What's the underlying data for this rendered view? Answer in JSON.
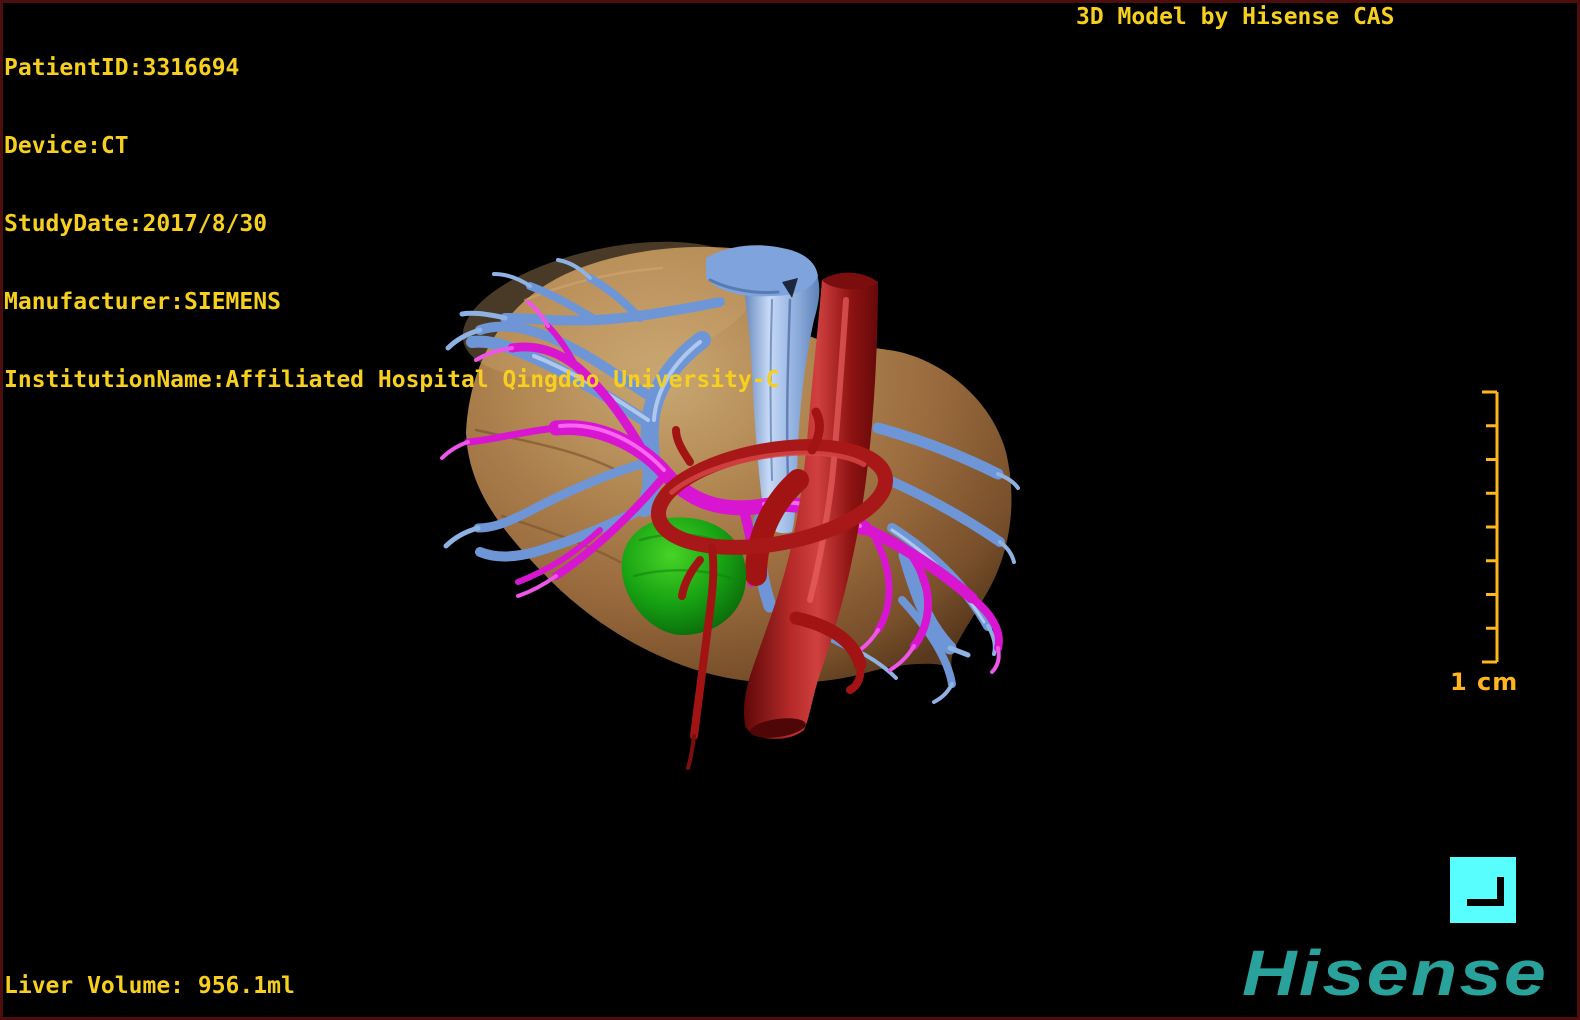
{
  "header": {
    "patient_lines": [
      "PatientID:3316694",
      "Device:CT",
      "StudyDate:2017/8/30",
      "Manufacturer:SIEMENS",
      "InstitutionName:Affiliated Hospital Qingdao University-C"
    ],
    "title": "3D Model by Hisense CAS"
  },
  "footer": {
    "liver_volume": "Liver Volume: 956.1ml",
    "brand": "Hisense"
  },
  "scalebar": {
    "label": "1 cm",
    "segments": 8
  },
  "colors": {
    "overlay_text": "#F7CF1E",
    "scale_bar": "#FFB61E",
    "border": "#4E0E0E",
    "brand_teal": "#28A29B",
    "orientation_icon": "#58FEFE",
    "liver_tan": "#A97C4F",
    "portal_vein_blue": "#6E96D6",
    "hepatic_vein_light_blue": "#9FBCE8",
    "artery_magenta": "#D816D2",
    "aorta_red": "#A21414",
    "gallbladder_green": "#17A213"
  }
}
